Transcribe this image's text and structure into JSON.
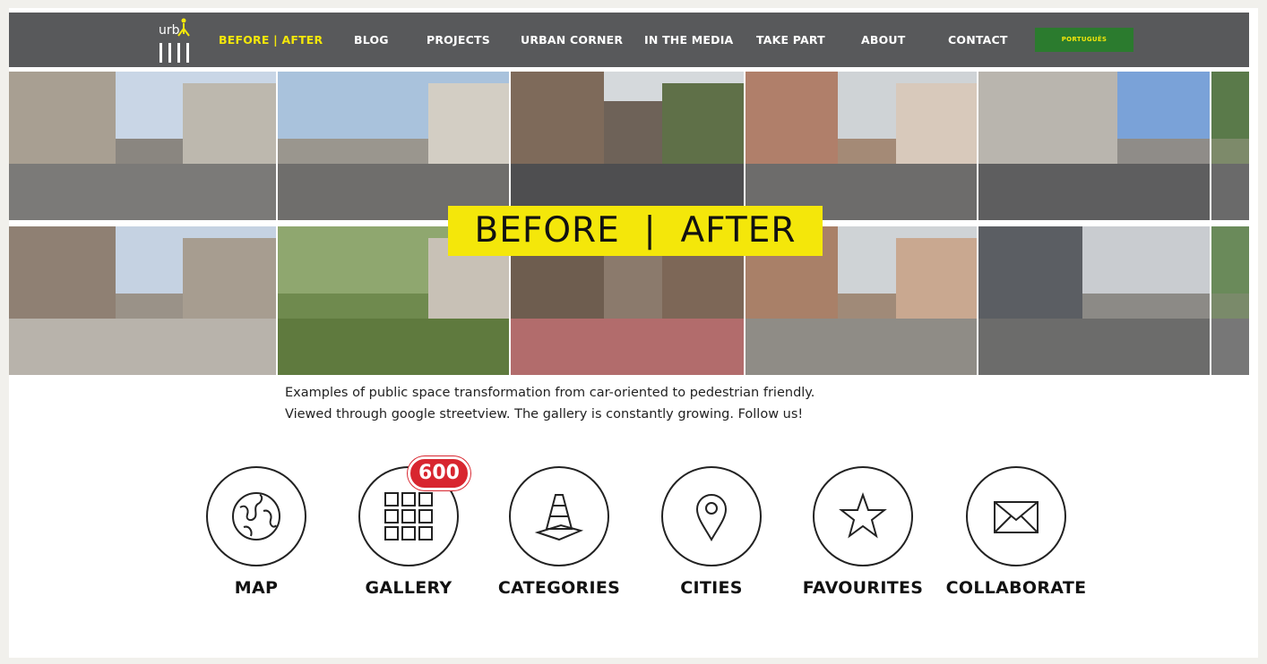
{
  "nav": {
    "items": [
      {
        "label": "BEFORE | AFTER",
        "active": true
      },
      {
        "label": "BLOG"
      },
      {
        "label": "PROJECTS"
      },
      {
        "label": "URBAN CORNER"
      },
      {
        "label": "IN THE MEDIA"
      },
      {
        "label": "TAKE PART"
      },
      {
        "label": "ABOUT"
      },
      {
        "label": "CONTACT"
      }
    ],
    "language_button": "PORTUGUÊS"
  },
  "hero": {
    "title": "BEFORE  |  AFTER"
  },
  "description": {
    "line1": "Examples of public space transformation from car-oriented to pedestrian friendly.",
    "line2": "Viewed through google streetview. The gallery is constantly growing. Follow us!"
  },
  "sections": [
    {
      "label": "MAP",
      "icon": "globe-icon"
    },
    {
      "label": "GALLERY",
      "icon": "grid-icon",
      "badge": "600"
    },
    {
      "label": "CATEGORIES",
      "icon": "traffic-cone-icon"
    },
    {
      "label": "CITIES",
      "icon": "map-pin-icon"
    },
    {
      "label": "FAVOURITES",
      "icon": "star-icon"
    },
    {
      "label": "COLLABORATE",
      "icon": "envelope-icon"
    }
  ],
  "colors": {
    "nav_bg": "#58595b",
    "accent_yellow": "#f4e70a",
    "language_green": "#2b7b2e",
    "badge_red": "#d8262f"
  }
}
